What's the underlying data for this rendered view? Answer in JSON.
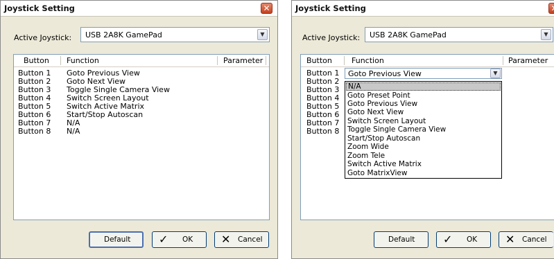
{
  "window_left": {
    "title": "Joystick Setting",
    "active_label": "Active Joystick:",
    "active_value": "USB 2A8K GamePad",
    "columns": [
      "Button",
      "Function",
      "Parameter"
    ],
    "rows": [
      {
        "button": "Button 1",
        "function": "Goto Previous View"
      },
      {
        "button": "Button 2",
        "function": "Goto Next View"
      },
      {
        "button": "Button 3",
        "function": "Toggle Single Camera View"
      },
      {
        "button": "Button 4",
        "function": "Switch Screen Layout"
      },
      {
        "button": "Button 5",
        "function": "Switch Active Matrix"
      },
      {
        "button": "Button 6",
        "function": "Start/Stop Autoscan"
      },
      {
        "button": "Button 7",
        "function": "N/A"
      },
      {
        "button": "Button 8",
        "function": "N/A"
      }
    ],
    "buttons": {
      "default": "Default",
      "ok": "OK",
      "cancel": "Cancel"
    }
  },
  "window_right": {
    "title": "Joystick Setting",
    "active_label": "Active Joystick:",
    "active_value": "USB 2A8K GamePad",
    "columns": [
      "Button",
      "Function",
      "Parameter"
    ],
    "rows": [
      "Button 1",
      "Button 2",
      "Button 3",
      "Button 4",
      "Button 5",
      "Button 6",
      "Button 7",
      "Button 8"
    ],
    "dropdown_selected": "Goto Previous View",
    "dropdown_options": [
      "N/A",
      "Goto Preset Point",
      "Goto Previous View",
      "Goto Next View",
      "Switch Screen Layout",
      "Toggle Single Camera View",
      "Start/Stop Autoscan",
      "Zoom Wide",
      "Zoom Tele",
      "Switch Active Matrix",
      "Goto MatrixView"
    ],
    "dropdown_highlighted": "N/A",
    "buttons": {
      "default": "Default",
      "ok": "OK",
      "cancel": "Cancel"
    }
  },
  "colors": {
    "title_bar": "#ffffff",
    "dialog_bg": "#ece9d8",
    "close_button": "#d85a3a",
    "ok_check": "#000000",
    "cancel_x": "#000000"
  },
  "icons": {
    "close": "close-x-icon",
    "dropdown": "chevron-down-icon",
    "ok": "checkmark-icon",
    "cancel": "x-mark-icon"
  }
}
